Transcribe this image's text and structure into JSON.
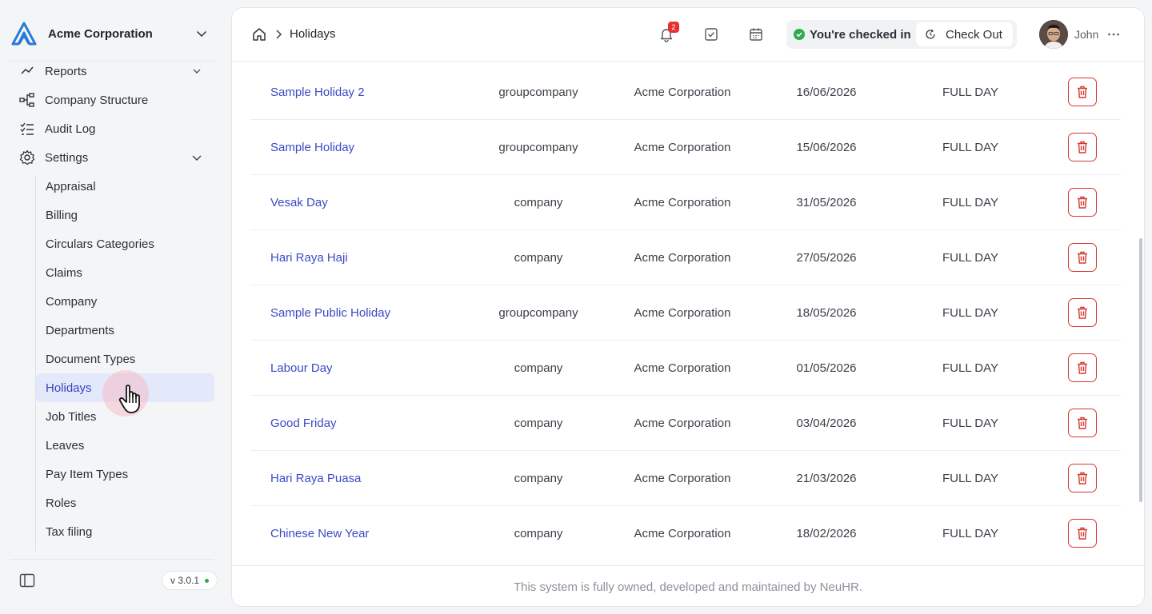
{
  "org": {
    "name": "Acme Corporation"
  },
  "sidebar": {
    "items": [
      {
        "label": "Reports",
        "icon": "reports-icon"
      },
      {
        "label": "Company Structure",
        "icon": "company-structure-icon"
      },
      {
        "label": "Audit Log",
        "icon": "audit-log-icon"
      },
      {
        "label": "Settings",
        "icon": "gear-icon"
      }
    ],
    "settings_subitems": [
      "Appraisal",
      "Billing",
      "Circulars Categories",
      "Claims",
      "Company",
      "Departments",
      "Document Types",
      "Holidays",
      "Job Titles",
      "Leaves",
      "Pay Item Types",
      "Roles",
      "Tax filing"
    ],
    "active_subitem": "Holidays",
    "version": "v 3.0.1"
  },
  "header": {
    "breadcrumb_current": "Holidays",
    "notification_count": "2",
    "checkin_status": "You're checked in",
    "checkout_label": "Check Out",
    "user_name": "John"
  },
  "holidays": [
    {
      "name": "Sample Holiday 2",
      "type": "groupcompany",
      "company": "Acme Corporation",
      "date": "16/06/2026",
      "duration": "FULL DAY"
    },
    {
      "name": "Sample Holiday",
      "type": "groupcompany",
      "company": "Acme Corporation",
      "date": "15/06/2026",
      "duration": "FULL DAY"
    },
    {
      "name": "Vesak Day",
      "type": "company",
      "company": "Acme Corporation",
      "date": "31/05/2026",
      "duration": "FULL DAY"
    },
    {
      "name": "Hari Raya Haji",
      "type": "company",
      "company": "Acme Corporation",
      "date": "27/05/2026",
      "duration": "FULL DAY"
    },
    {
      "name": "Sample Public Holiday",
      "type": "groupcompany",
      "company": "Acme Corporation",
      "date": "18/05/2026",
      "duration": "FULL DAY"
    },
    {
      "name": "Labour Day",
      "type": "company",
      "company": "Acme Corporation",
      "date": "01/05/2026",
      "duration": "FULL DAY"
    },
    {
      "name": "Good Friday",
      "type": "company",
      "company": "Acme Corporation",
      "date": "03/04/2026",
      "duration": "FULL DAY"
    },
    {
      "name": "Hari Raya Puasa",
      "type": "company",
      "company": "Acme Corporation",
      "date": "21/03/2026",
      "duration": "FULL DAY"
    },
    {
      "name": "Chinese New Year",
      "type": "company",
      "company": "Acme Corporation",
      "date": "18/02/2026",
      "duration": "FULL DAY"
    }
  ],
  "footer": {
    "text": "This system is fully owned, developed and maintained by NeuHR."
  },
  "colors": {
    "accent": "#3b4ac4",
    "danger": "#d6382e",
    "success": "#2eaa4d",
    "active_bg": "#e4e8fb"
  }
}
